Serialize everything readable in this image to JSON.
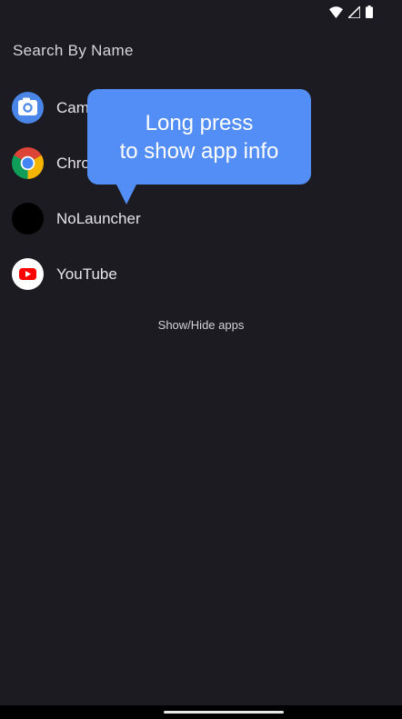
{
  "search": {
    "placeholder": "Search By Name"
  },
  "apps": [
    {
      "label": "Camera",
      "icon": "camera-icon"
    },
    {
      "label": "Chrome",
      "icon": "chrome-icon"
    },
    {
      "label": "NoLauncher",
      "icon": "nolauncher-icon"
    },
    {
      "label": "YouTube",
      "icon": "youtube-icon"
    }
  ],
  "show_hide_label": "Show/Hide apps",
  "tooltip": {
    "line1": "Long press",
    "line2": "to show app info"
  },
  "colors": {
    "background": "#1c1b21",
    "tooltip": "#528ef5"
  }
}
